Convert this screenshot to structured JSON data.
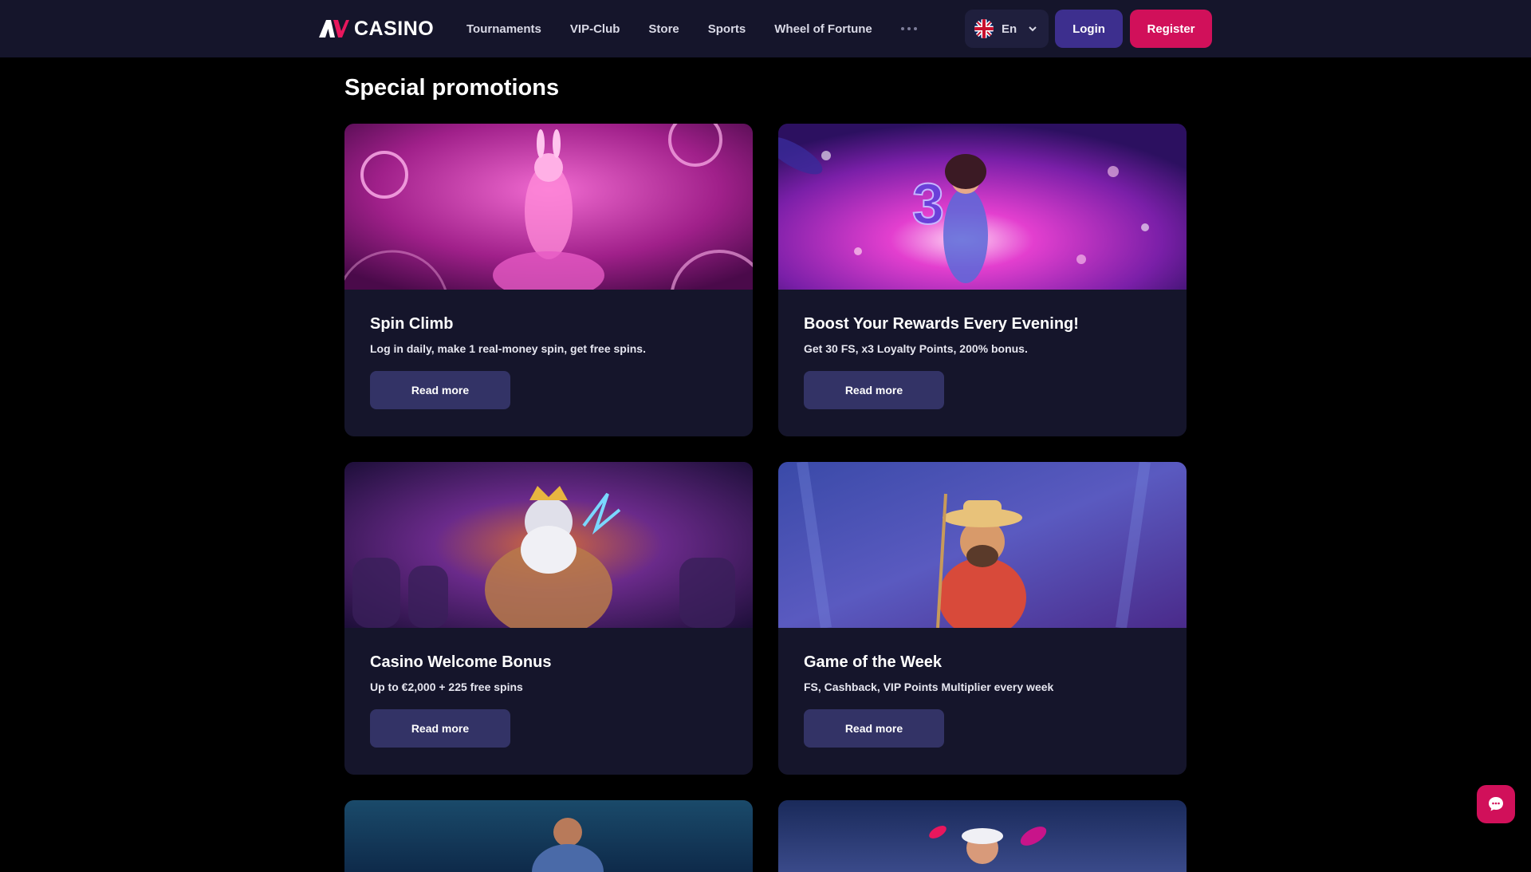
{
  "header": {
    "logo_text": "CASINO",
    "logo_mark_icon": "av-logo-icon",
    "nav": [
      {
        "label": "Tournaments"
      },
      {
        "label": "VIP-Club"
      },
      {
        "label": "Store"
      },
      {
        "label": "Sports"
      },
      {
        "label": "Wheel of Fortune"
      }
    ],
    "more_icon": "more-dots-icon",
    "language": {
      "label": "En",
      "flag_icon": "uk-flag-icon",
      "chevron_icon": "chevron-down-icon"
    },
    "login_label": "Login",
    "register_label": "Register"
  },
  "main": {
    "title": "Special promotions",
    "promotions": [
      {
        "title": "Spin Climb",
        "description": "Log in daily, make 1 real-money spin, get free spins.",
        "button": "Read more"
      },
      {
        "title": "Boost Your Rewards Every Evening!",
        "description": "Get 30 FS, x3 Loyalty Points, 200% bonus.",
        "button": "Read more"
      },
      {
        "title": "Casino Welcome Bonus",
        "description": "Up to €2,000 + 225 free spins",
        "button": "Read more"
      },
      {
        "title": "Game of the Week",
        "description": "FS, Cashback, VIP Points Multiplier every week",
        "button": "Read more"
      }
    ]
  },
  "chat_icon": "chat-bubble-icon",
  "colors": {
    "background": "#000000",
    "header": "#15152b",
    "card": "#15152b",
    "card_button": "#333366",
    "login": "#3d2f8e",
    "register": "#d1105a"
  }
}
